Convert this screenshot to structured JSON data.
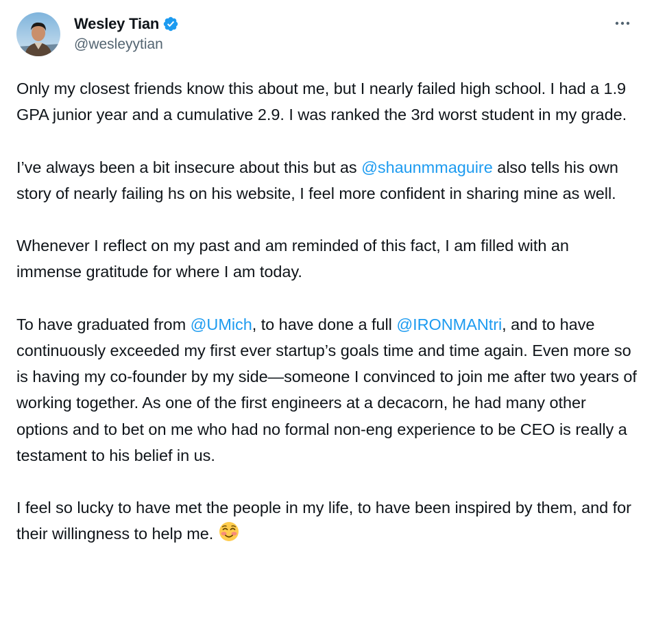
{
  "author": {
    "display_name": "Wesley Tian",
    "handle": "@wesleyytian",
    "verified": true,
    "verified_color": "#1d9bf0",
    "avatar_icon": "avatar-photo"
  },
  "menu": {
    "more_icon": "more-horizontal-icon"
  },
  "tweet": {
    "p1": "Only my closest friends know this about me, but I nearly failed high school. I had a 1.9 GPA junior year and a cumulative 2.9. I was ranked the 3rd worst student in my grade.",
    "p2_a": "I’ve always been a bit insecure about this but as ",
    "p2_mention": "@shaunmmaguire",
    "p2_b": " also tells his own story of nearly failing hs on his website, I feel more confident in sharing mine as well.",
    "p3": "Whenever I reflect on my past and am reminded of this fact, I am filled with an immense gratitude for where I am today.",
    "p4_a": "To have graduated from ",
    "p4_mention1": "@UMich",
    "p4_b": ", to have done a full ",
    "p4_mention2": "@IRONMANtri",
    "p4_c": ", and to have continuously exceeded my first ever startup’s goals time and time again. Even more so is having my co-founder by my side—someone I convinced to join me after two years of working together. As one of the first engineers at a decacorn, he had many other options and to bet on me who had no formal non-eng experience to be CEO is really a testament to his belief in us.",
    "p5": "I feel so lucky to have met the people in my life, to have been inspired by them, and for their willingness to help me.",
    "p5_emoji": "smiling-face-emoji"
  },
  "colors": {
    "text": "#0f1419",
    "secondary": "#536471",
    "link": "#1d9bf0"
  }
}
